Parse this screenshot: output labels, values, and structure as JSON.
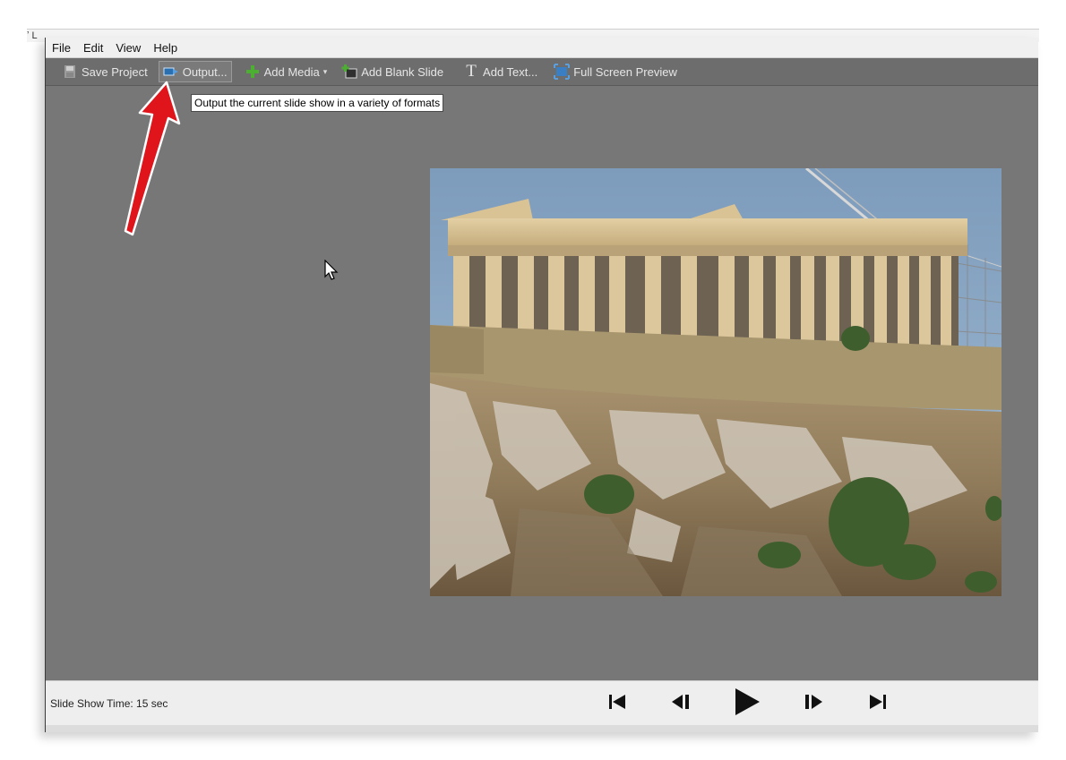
{
  "menu": [
    "File",
    "Edit",
    "View",
    "Help"
  ],
  "toolbar": {
    "save_project": "Save Project",
    "output": "Output...",
    "add_media": "Add Media",
    "add_blank_slide": "Add Blank Slide",
    "add_text": "Add Text...",
    "full_screen_preview": "Full Screen Preview"
  },
  "tooltip": "Output the current slide show in a variety of formats",
  "status": {
    "slide_show_time": "Slide Show Time: 15 sec"
  },
  "colors": {
    "workspace": "#777777",
    "toolbar": "#6d6d6d",
    "annotation_arrow": "#e0141b"
  },
  "icons": [
    "save-icon",
    "output-icon",
    "add-media-icon",
    "add-blank-slide-icon",
    "text-icon",
    "full-screen-icon",
    "first-slide-icon",
    "previous-slide-icon",
    "play-icon",
    "next-slide-icon",
    "last-slide-icon"
  ]
}
